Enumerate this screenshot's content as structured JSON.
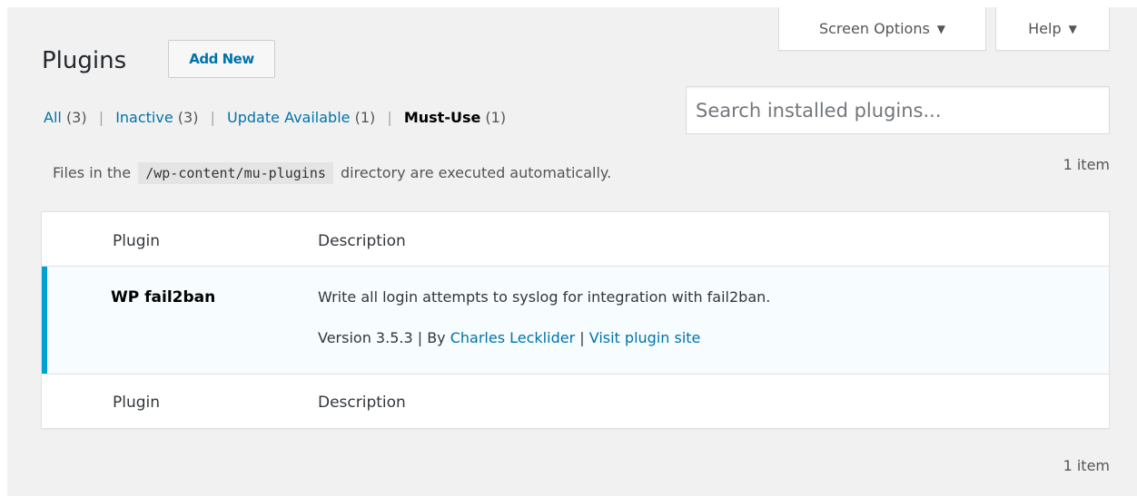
{
  "header": {
    "title": "Plugins",
    "add_new_label": "Add New",
    "screen_options_label": "Screen Options",
    "help_label": "Help",
    "dropdown_icon": "▼"
  },
  "filters": {
    "all_label": "All",
    "all_count": "(3)",
    "inactive_label": "Inactive",
    "inactive_count": "(3)",
    "update_label": "Update Available",
    "update_count": "(1)",
    "mustuse_label": "Must-Use",
    "mustuse_count": "(1)",
    "separator": "|"
  },
  "search": {
    "placeholder": "Search installed plugins..."
  },
  "notice": {
    "before": "Files in the",
    "path": "/wp-content/mu-plugins",
    "after": "directory are executed automatically."
  },
  "pagination": {
    "top_count": "1 item",
    "bottom_count": "1 item"
  },
  "table": {
    "columns": [
      "Plugin",
      "Description"
    ],
    "rows": [
      {
        "name": "WP fail2ban",
        "description": "Write all login attempts to syslog for integration with fail2ban.",
        "version_text": "Version 3.5.3 | By",
        "author": "Charles Lecklider",
        "separator": "|",
        "site_link": "Visit plugin site"
      }
    ]
  },
  "colors": {
    "link": "#0073aa",
    "active_row_border": "#00a0d2",
    "active_row_bg": "#f7fcfe",
    "page_bg": "#f1f1f1"
  }
}
